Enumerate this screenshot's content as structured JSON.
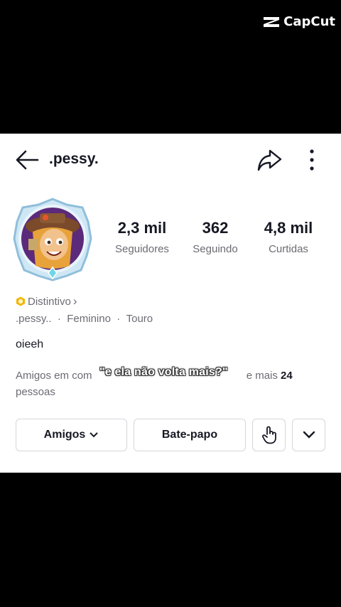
{
  "watermark": {
    "label": "CapCut"
  },
  "header": {
    "username": ".pessy."
  },
  "stats": [
    {
      "value": "2,3 mil",
      "label": "Seguidores"
    },
    {
      "value": "362",
      "label": "Seguindo"
    },
    {
      "value": "4,8 mil",
      "label": "Curtidas"
    }
  ],
  "badge": {
    "label": "Distintivo",
    "chevron": "›"
  },
  "info": {
    "name": ".pessy..",
    "sep1": "  ·  ",
    "gender": "Feminino",
    "sep2": "  ·  ",
    "sign": "Touro"
  },
  "bio": "oieeh",
  "friends": {
    "prefix": "Amigos em com",
    "suffix": " e mais ",
    "count": "24",
    "line2": "pessoas"
  },
  "caption": "\"e ela não volta mais?\"",
  "buttons": {
    "friends": "Amigos",
    "chat": "Bate-papo"
  },
  "colors": {
    "text": "#161823",
    "muted": "#6b6b73",
    "border": "#d6d6dc",
    "badge": "#f4b400"
  }
}
